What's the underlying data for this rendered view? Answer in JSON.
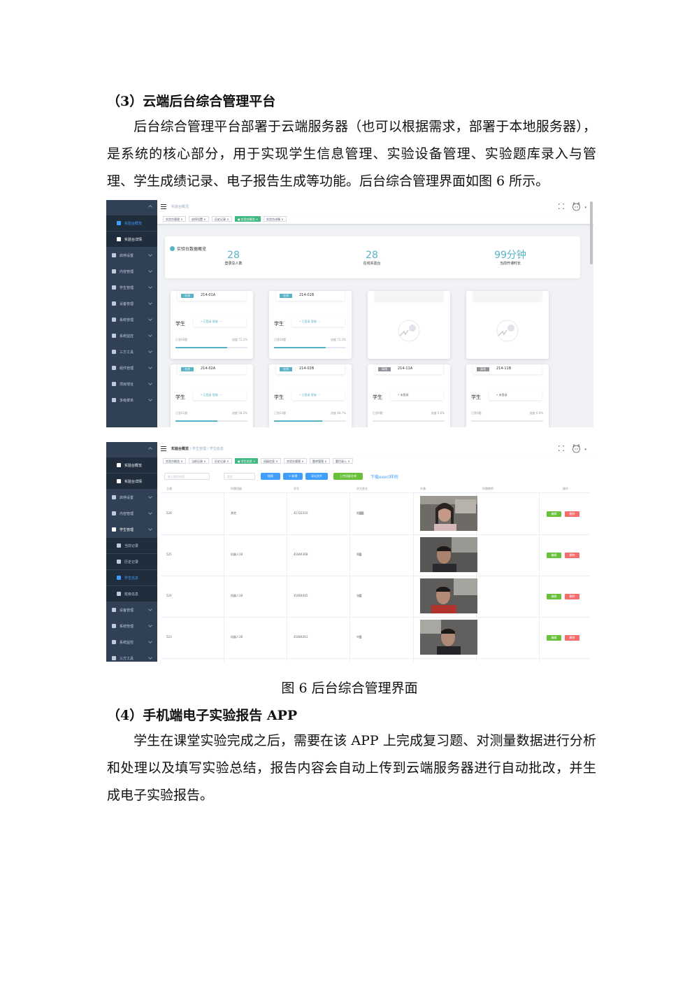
{
  "doc": {
    "heading3": "（3）云端后台综合管理平台",
    "para1": "后台综合管理平台部署于云端服务器（也可以根据需求，部署于本地服务器），是系统的核心部分，用于实现学生信息管理、实验设备管理、实验题库录入与管理、学生成绩记录、电子报告生成等功能。后台综合管理界面如图 6 所示。",
    "caption": "图 6 后台综合管理界面",
    "heading4": "（4）手机端电子实验报告 APP",
    "para2": "学生在课堂实验完成之后，需要在该 APP 上完成复习题、对测量数据进行分析和处理以及填写实验总结，报告内容会自动上传到云端服务器进行自动批改，并生成电子实验报告。"
  },
  "shot1": {
    "breadcrumb": "实验台概况",
    "sidebar": [
      {
        "label": "实验台概览",
        "icon": "dashboard-icon",
        "sub": true,
        "active": true
      },
      {
        "label": "实验台详情",
        "icon": "dashboard-icon",
        "sub": true,
        "white": true
      },
      {
        "label": "启停设置",
        "icon": "power-icon"
      },
      {
        "label": "内容管理",
        "icon": "monitor-icon"
      },
      {
        "label": "学生管理",
        "icon": "eye-icon"
      },
      {
        "label": "设备管理",
        "icon": "gear-icon"
      },
      {
        "label": "系统管理",
        "icon": "gear-icon"
      },
      {
        "label": "系统监控",
        "icon": "monitor-icon"
      },
      {
        "label": "三方工具",
        "icon": "tool-icon"
      },
      {
        "label": "组件管理",
        "icon": "component-icon"
      },
      {
        "label": "项目地址",
        "icon": "link-icon"
      },
      {
        "label": "多级菜单",
        "icon": "list-icon"
      }
    ],
    "tags": [
      {
        "label": "实验台管理 ×"
      },
      {
        "label": "启停设置 ×"
      },
      {
        "label": "历史记录 ×"
      },
      {
        "label": "● 实验台概览 ×",
        "on": true
      },
      {
        "label": "实验台详情 ×"
      }
    ],
    "summary_title": "实验台数据概览",
    "stats": [
      {
        "value": "28",
        "label": "登录总人数"
      },
      {
        "value": "28",
        "label": "在线实验台"
      },
      {
        "value": "99分钟",
        "label": "当前开课时长"
      }
    ],
    "cards": [
      {
        "badge": "在线",
        "id": "214-01A",
        "student": "学生",
        "status": "• 已登录 智能 ···",
        "done": "已答26题",
        "progress_text": "进度 72.2%",
        "progress": 0.722
      },
      {
        "badge": "在线",
        "id": "214-01B",
        "student": "学生",
        "status": "• 已登录 智能 ···",
        "done": "已答26题",
        "progress_text": "进度 72.2%",
        "progress": 0.722
      },
      {
        "badge": "在线",
        "id": "214-02A",
        "student": "学生",
        "status": "• 已登录 智能 ···",
        "done": "已答21题",
        "progress_text": "进度 58.3%",
        "progress": 0.583
      },
      {
        "badge": "在线",
        "id": "214-02B",
        "student": "学生",
        "status": "• 已登录 智能 ···",
        "done": "已答24题",
        "progress_text": "进度 66.7%",
        "progress": 0.667
      },
      {
        "badge": "离线",
        "id": "214-11A",
        "student": "学生",
        "status": "• 未登录",
        "done": "已答0题",
        "progress_text": "进度 0.0%",
        "progress": 0
      },
      {
        "badge": "离线",
        "id": "214-11B",
        "student": "学生",
        "status": "• 未登录",
        "done": "已答0题",
        "progress_text": "进度 0.0%",
        "progress": 0
      }
    ]
  },
  "shot2": {
    "breadcrumb_main": "实验台概览",
    "breadcrumb_rest": " / 学生管理 / 学生信息",
    "sidebar": [
      {
        "label": "实验台概览",
        "icon": "dashboard-icon",
        "sub": true,
        "white": true
      },
      {
        "label": "实验台详情",
        "icon": "dashboard-icon",
        "sub": true,
        "white": true
      },
      {
        "label": "启停设置",
        "icon": "power-icon"
      },
      {
        "label": "内容管理",
        "icon": "monitor-icon"
      },
      {
        "label": "学生管理",
        "icon": "eye-icon",
        "white": true
      },
      {
        "label": "当前记录",
        "icon": "record-icon",
        "sub": true
      },
      {
        "label": "历史记录",
        "icon": "user-icon",
        "sub": true
      },
      {
        "label": "学生信息",
        "icon": "card-icon",
        "sub": true,
        "active": true
      },
      {
        "label": "班级信息",
        "icon": "link-icon",
        "sub": true
      },
      {
        "label": "设备管理",
        "icon": "gear-icon"
      },
      {
        "label": "系统管理",
        "icon": "gear-icon"
      },
      {
        "label": "系统监控",
        "icon": "monitor-icon"
      },
      {
        "label": "三方工具",
        "icon": "tool-icon"
      }
    ],
    "tags": [
      {
        "label": "实验台概览 ×"
      },
      {
        "label": "当前记录 ×"
      },
      {
        "label": "历史记录 ×"
      },
      {
        "label": "● 学生信息 ×",
        "on": true
      },
      {
        "label": "班级信息 ×"
      },
      {
        "label": "实验台管理 ×"
      },
      {
        "label": "题库管理 ×"
      },
      {
        "label": "题目录入 ×"
      }
    ],
    "search_placeholder": "输入搜索内容",
    "select_placeholder": "类型",
    "buttons": {
      "search": "搜索",
      "add": "+ 新增",
      "export": "导出文件",
      "import": "上传班级名单"
    },
    "download_link": "下载execl样例",
    "columns": [
      "主键",
      "所属班级",
      "学号",
      "学生姓名",
      "头像",
      "所属教师",
      "操作"
    ],
    "rows": [
      {
        "id": "526",
        "class": "其他",
        "number": "41722310",
        "name": "阳▒▒"
      },
      {
        "id": "525",
        "class": "机器人18",
        "number": "41804368",
        "name": "郑▒"
      },
      {
        "id": "524",
        "class": "机器人18",
        "number": "41804045",
        "name": "张▒"
      },
      {
        "id": "523",
        "class": "机器人18",
        "number": "41804261",
        "name": "许▒"
      }
    ],
    "edit_label": "编辑",
    "delete_label": "删除"
  }
}
